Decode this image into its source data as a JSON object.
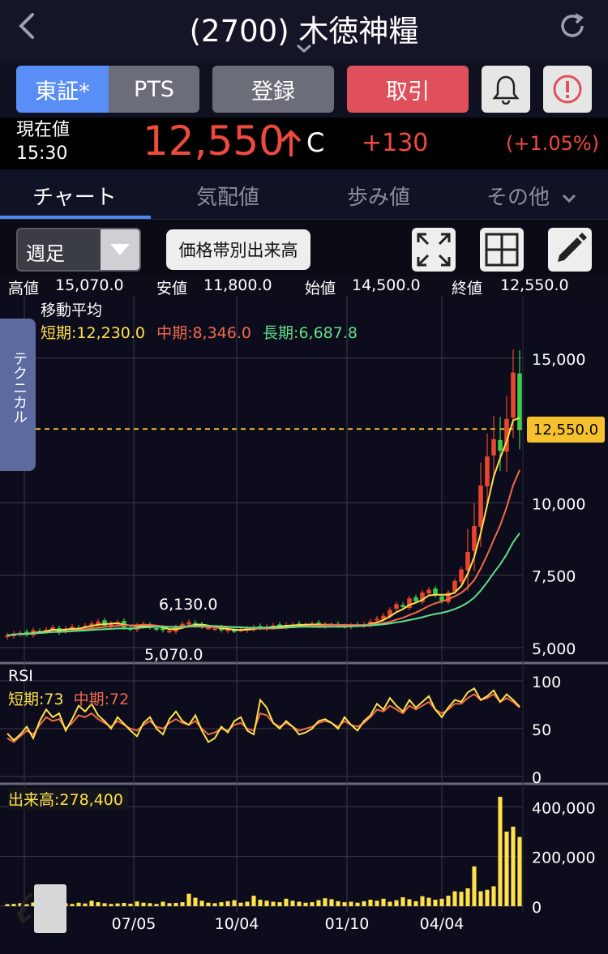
{
  "header": {
    "title": "(2700) 木徳神糧",
    "icons": {
      "back": "chevron-left-icon",
      "refresh": "refresh-icon",
      "expand": "chevron-down-icon"
    }
  },
  "toolbar": {
    "market_tosho": "東証*",
    "market_pts": "PTS",
    "register_label": "登録",
    "trade_label": "取引",
    "colors": {
      "active": "#5a8ef7",
      "trade": "#e0505c"
    }
  },
  "price": {
    "label": "現在値",
    "time": "15:30",
    "value": "12,550",
    "flag": "C",
    "change": "+130",
    "change_pct": "(+1.05%)",
    "color": "#f04a3e"
  },
  "tabs": [
    {
      "label": "チャート",
      "active": true
    },
    {
      "label": "気配値",
      "active": false
    },
    {
      "label": "歩み値",
      "active": false
    },
    {
      "label": "その他",
      "active": false
    }
  ],
  "controls": {
    "period": "週足",
    "volume_profile": "価格帯別出来高"
  },
  "ohlc": {
    "high_label": "高値",
    "high": "15,070.0",
    "low_label": "安値",
    "low": "11,800.0",
    "open_label": "始値",
    "open": "14,500.0",
    "close_label": "終値",
    "close": "12,550.0"
  },
  "technical_tab": "テクニカル",
  "ma": {
    "title": "移動平均",
    "short": "短期:12,230.0",
    "mid": "中期:8,346.0",
    "long": "長期:6,687.8"
  },
  "rsi": {
    "title": "RSI",
    "short": "短期:73",
    "mid": "中期:72"
  },
  "volume_title": "出来高:278,400",
  "chart_data": {
    "type": "candlestick",
    "price_axis": {
      "ticks": [
        "15,000",
        "10,000",
        "7,500",
        "5,000"
      ],
      "tick_values": [
        15000,
        10000,
        7500,
        5000
      ],
      "ylim": [
        4550,
        17150
      ]
    },
    "last_price_label": "12,550.0",
    "last_price": 12550,
    "annotations": [
      {
        "text": "6,130.0",
        "value": 6130
      },
      {
        "text": "5,070.0",
        "value": 5070
      }
    ],
    "x_ticks": [
      "07/05",
      "10/04",
      "01/10",
      "04/04"
    ],
    "rsi_axis": {
      "ticks": [
        "100",
        "50",
        "0"
      ],
      "ylim": [
        0,
        100
      ]
    },
    "volume_axis": {
      "ticks": [
        "400,000",
        "200,000",
        "0"
      ],
      "ylim": [
        0,
        450000
      ]
    },
    "closes": [
      5420,
      5480,
      5510,
      5450,
      5600,
      5560,
      5620,
      5700,
      5520,
      5650,
      5720,
      5680,
      5750,
      5830,
      5900,
      5760,
      5820,
      5880,
      5700,
      5640,
      5760,
      5820,
      5700,
      5650,
      5600,
      5580,
      5700,
      5820,
      5880,
      5760,
      5720,
      5690,
      5660,
      5600,
      5630,
      5580,
      5620,
      5650,
      5700,
      5680,
      5720,
      5760,
      5740,
      5780,
      5790,
      5800,
      5780,
      5820,
      5760,
      5800,
      5780,
      5760,
      5740,
      5760,
      5780,
      5800,
      5900,
      6000,
      6100,
      6300,
      6500,
      6400,
      6700,
      6600,
      6900,
      7000,
      6800,
      6600,
      6900,
      7300,
      7700,
      8300,
      9200,
      10600,
      11600,
      12200,
      11800,
      12900,
      14500,
      12550
    ],
    "volumes": [
      8000,
      9000,
      12000,
      8000,
      15000,
      11000,
      9000,
      18000,
      10000,
      12000,
      9000,
      14000,
      11000,
      22000,
      16000,
      12000,
      9000,
      11000,
      13000,
      10000,
      19000,
      14000,
      12000,
      9000,
      18000,
      12000,
      13000,
      16000,
      50000,
      34000,
      22000,
      14000,
      12000,
      16000,
      20000,
      24000,
      14000,
      18000,
      42000,
      26000,
      22000,
      18000,
      16000,
      30000,
      22000,
      18000,
      14000,
      16000,
      24000,
      32000,
      28000,
      20000,
      16000,
      18000,
      14000,
      20000,
      26000,
      22000,
      30000,
      18000,
      24000,
      36000,
      28000,
      20000,
      40000,
      34000,
      26000,
      30000,
      42000,
      60000,
      58000,
      72000,
      160000,
      60000,
      66000,
      80000,
      440000,
      300000,
      320000,
      278400
    ],
    "rsi_short": [
      45,
      38,
      44,
      52,
      40,
      58,
      70,
      62,
      66,
      48,
      60,
      74,
      68,
      76,
      64,
      58,
      50,
      62,
      55,
      48,
      42,
      56,
      62,
      50,
      44,
      60,
      68,
      58,
      54,
      64,
      48,
      36,
      40,
      52,
      46,
      58,
      62,
      48,
      44,
      80,
      72,
      56,
      50,
      58,
      52,
      44,
      46,
      50,
      58,
      60,
      56,
      50,
      62,
      54,
      48,
      58,
      64,
      76,
      70,
      82,
      74,
      68,
      80,
      72,
      78,
      84,
      70,
      62,
      72,
      80,
      78,
      88,
      92,
      80,
      84,
      90,
      78,
      86,
      80,
      73
    ],
    "rsi_mid": [
      40,
      36,
      42,
      48,
      44,
      54,
      62,
      58,
      60,
      50,
      56,
      64,
      62,
      66,
      60,
      56,
      52,
      58,
      54,
      50,
      48,
      54,
      58,
      52,
      50,
      56,
      60,
      56,
      54,
      58,
      50,
      44,
      46,
      50,
      48,
      54,
      56,
      50,
      48,
      66,
      64,
      56,
      52,
      56,
      52,
      48,
      50,
      52,
      56,
      58,
      56,
      52,
      58,
      54,
      52,
      56,
      62,
      70,
      68,
      74,
      70,
      66,
      74,
      70,
      74,
      78,
      70,
      66,
      70,
      76,
      76,
      82,
      86,
      80,
      82,
      86,
      78,
      82,
      78,
      72
    ]
  }
}
